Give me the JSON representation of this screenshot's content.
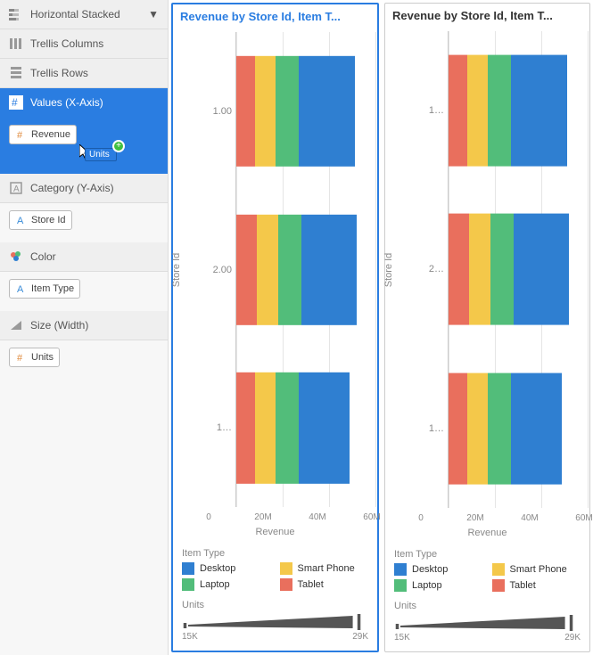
{
  "sidebar": {
    "chart_type": "Horizontal Stacked",
    "trellis_columns": "Trellis Columns",
    "trellis_rows": "Trellis Rows",
    "values_label": "Values (X-Axis)",
    "values_chip": "Revenue",
    "drag_ghost": "Units",
    "category_label": "Category (Y-Axis)",
    "category_chip": "Store Id",
    "color_label": "Color",
    "color_chip": "Item Type",
    "size_label": "Size (Width)",
    "size_chip": "Units"
  },
  "panels": [
    {
      "title": "Revenue by Store Id, Item T...",
      "selected": true,
      "ycats": [
        "1.00",
        "2.00",
        "1…"
      ]
    },
    {
      "title": "Revenue by Store Id, Item T...",
      "selected": false,
      "ycats": [
        "1…",
        "2…",
        "1…"
      ]
    }
  ],
  "axis": {
    "ylabel": "Store Id",
    "xlabel": "Revenue",
    "xmax": 60,
    "xticks": [
      0,
      20,
      40,
      60
    ],
    "xtick_labels": [
      "0",
      "20M",
      "40M",
      "60M"
    ]
  },
  "legend": {
    "title": "Item Type",
    "items": [
      {
        "label": "Desktop",
        "color": "#2f7fd1"
      },
      {
        "label": "Smart Phone",
        "color": "#f4c84a"
      },
      {
        "label": "Laptop",
        "color": "#52bd7a"
      },
      {
        "label": "Tablet",
        "color": "#e96f5d"
      }
    ]
  },
  "size_legend": {
    "title": "Units",
    "min": "15K",
    "max": "29K"
  },
  "chart_data": {
    "type": "bar",
    "orientation": "horizontal-stacked",
    "xlabel": "Revenue",
    "ylabel": "Store Id",
    "xlim": [
      0,
      60000000
    ],
    "categories": [
      "1.00",
      "2.00",
      "1…"
    ],
    "series": [
      {
        "name": "Tablet",
        "color": "#e96f5d",
        "values": [
          8000000,
          9000000,
          8000000
        ]
      },
      {
        "name": "Smart Phone",
        "color": "#f4c84a",
        "values": [
          9000000,
          9000000,
          9000000
        ]
      },
      {
        "name": "Laptop",
        "color": "#52bd7a",
        "values": [
          10000000,
          10000000,
          10000000
        ]
      },
      {
        "name": "Desktop",
        "color": "#2f7fd1",
        "values": [
          24000000,
          24000000,
          22000000
        ]
      }
    ],
    "xticks": [
      0,
      20000000,
      40000000,
      60000000
    ]
  }
}
